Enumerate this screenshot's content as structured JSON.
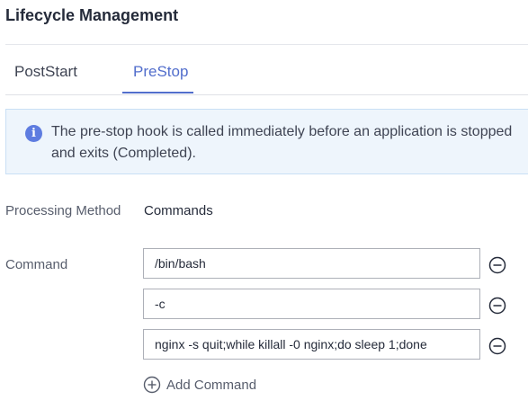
{
  "header": {
    "title": "Lifecycle Management"
  },
  "tabs": [
    {
      "label": "PostStart",
      "active": false
    },
    {
      "label": "PreStop",
      "active": true
    }
  ],
  "info": {
    "icon": "info-icon",
    "text": "The pre-stop hook is called immediately before an application is stopped and exits (Completed)."
  },
  "form": {
    "processing_method": {
      "label": "Processing Method",
      "value": "Commands"
    },
    "command": {
      "label": "Command",
      "values": [
        "/bin/bash",
        "-c",
        "nginx -s quit;while killall -0 nginx;do sleep 1;done"
      ],
      "remove_icon": "minus-circle-icon"
    },
    "add_command": {
      "label": "Add Command",
      "icon": "plus-circle-icon"
    }
  },
  "colors": {
    "accent": "#526ecc",
    "info_background": "#eef5fc",
    "info_icon": "#5e7ce0"
  }
}
